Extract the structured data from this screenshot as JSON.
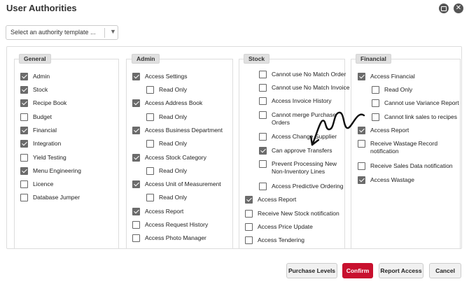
{
  "window": {
    "title": "User Authorities",
    "minimize_icon": "window-restore-icon",
    "close_icon": "close-icon"
  },
  "template": {
    "placeholder": "Select an authority template ..."
  },
  "columns": {
    "general": {
      "header": "General",
      "items": [
        {
          "label": "Admin",
          "checked": true
        },
        {
          "label": "Stock",
          "checked": true
        },
        {
          "label": "Recipe Book",
          "checked": true
        },
        {
          "label": "Budget",
          "checked": false
        },
        {
          "label": "Financial",
          "checked": true
        },
        {
          "label": "Integration",
          "checked": true
        },
        {
          "label": "Yield Testing",
          "checked": false
        },
        {
          "label": "Menu Engineering",
          "checked": true
        },
        {
          "label": "Licence",
          "checked": false
        },
        {
          "label": "Database Jumper",
          "checked": false
        }
      ]
    },
    "admin": {
      "header": "Admin",
      "items": [
        {
          "label": "Access Settings",
          "checked": true
        },
        {
          "label": "Read Only",
          "checked": false
        },
        {
          "label": "Access Address Book",
          "checked": true
        },
        {
          "label": "Read Only",
          "checked": false
        },
        {
          "label": "Access Business Department",
          "checked": true
        },
        {
          "label": "Read Only",
          "checked": false
        },
        {
          "label": "Access Stock Category",
          "checked": true
        },
        {
          "label": "Read Only",
          "checked": false
        },
        {
          "label": "Access Unit of Measurement",
          "checked": true
        },
        {
          "label": "Read Only",
          "checked": false
        },
        {
          "label": "Access Report",
          "checked": true
        },
        {
          "label": "Access Request History",
          "checked": false
        },
        {
          "label": "Access Photo Manager",
          "checked": false
        }
      ]
    },
    "stock": {
      "header": "Stock",
      "items": [
        {
          "label": "Cannot use No Match Order",
          "checked": false
        },
        {
          "label": "Cannot use No Match Invoice",
          "checked": false
        },
        {
          "label": "Access Invoice History",
          "checked": false
        },
        {
          "label": "Cannot merge Purchase Orders",
          "checked": false
        },
        {
          "label": "Access Change Supplier",
          "checked": false
        },
        {
          "label": "Can approve Transfers",
          "checked": true
        },
        {
          "label": "Prevent Processing New Non-Inventory Lines",
          "checked": false
        },
        {
          "label": "Access Predictive Ordering",
          "checked": false
        },
        {
          "label": "Access Report",
          "checked": true
        },
        {
          "label": "Receive New Stock notification",
          "checked": false
        },
        {
          "label": "Access Price Update",
          "checked": false
        },
        {
          "label": "Access Tendering",
          "checked": false
        }
      ]
    },
    "financial": {
      "header": "Financial",
      "items": [
        {
          "label": "Access Financial",
          "checked": true
        },
        {
          "label": "Read Only",
          "checked": false
        },
        {
          "label": "Cannot use Variance Report",
          "checked": false
        },
        {
          "label": "Cannot link sales to recipes",
          "checked": false
        },
        {
          "label": "Access Report",
          "checked": true
        },
        {
          "label": "Receive Wastage Record notification",
          "checked": false
        },
        {
          "label": "Receive Sales Data notification",
          "checked": false
        },
        {
          "label": "Access Wastage",
          "checked": true
        }
      ]
    }
  },
  "buttons": {
    "purchase_levels": "Purchase Levels",
    "confirm": "Confirm",
    "report_access": "Report Access",
    "cancel": "Cancel"
  },
  "colors": {
    "accent": "#c8102e",
    "checkbox_checked": "#6b6b6b",
    "header_bg": "#e0e0e0"
  }
}
